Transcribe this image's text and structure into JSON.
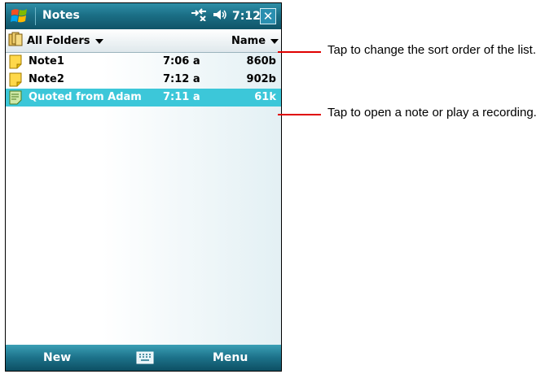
{
  "titlebar": {
    "title": "Notes",
    "clock": "7:12",
    "close_label": "✕"
  },
  "toolbar": {
    "folder_label": "All Folders",
    "sort_label": "Name"
  },
  "notes": [
    {
      "name": "Note1",
      "time": "7:06 a",
      "size": "860b"
    },
    {
      "name": "Note2",
      "time": "7:12 a",
      "size": "902b"
    },
    {
      "name": "Quoted from Adam",
      "time": "7:11 a",
      "size": "61k"
    }
  ],
  "menubar": {
    "left_softkey": "New",
    "right_softkey": "Menu"
  },
  "callouts": {
    "sort_hint": "Tap to change the sort order of the list.",
    "open_hint": "Tap to open a note or play a recording."
  },
  "colors": {
    "selection": "#3cc7d9",
    "callout_line": "#e00000"
  },
  "icons": [
    "windows-start-icon",
    "connectivity-icon",
    "speaker-icon",
    "close-icon",
    "folder-icon",
    "chevron-down-icon",
    "note-icon",
    "voice-note-icon",
    "keyboard-icon"
  ]
}
